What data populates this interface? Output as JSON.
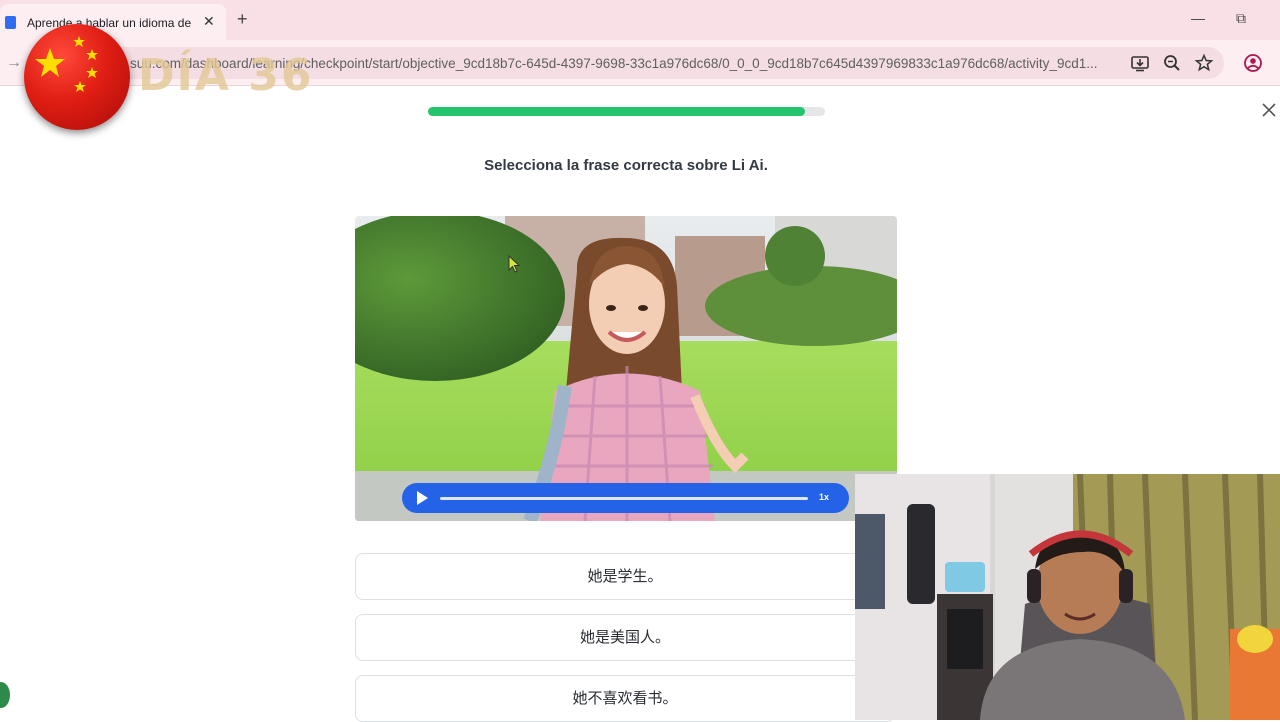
{
  "browser": {
    "tab_title": "Aprende a hablar un idioma de",
    "tab_close": "✕",
    "new_tab": "+",
    "url": "suu.com/dashboard/learning/checkpoint/start/objective_9cd18b7c-645d-4397-9698-33c1a976dc68/0_0_0_9cd18b7c645d4397969833c1a976dc68/activity_9cd1...",
    "minimize": "—",
    "restore": "⧉"
  },
  "overlay": {
    "day_label": "DÍA 36"
  },
  "lesson": {
    "progress_fraction": 0.95,
    "prompt": "Selecciona la frase correcta sobre Li Ai.",
    "audio_speed": "1x",
    "options": [
      {
        "text": "她是学生。"
      },
      {
        "text": "她是美国人。"
      },
      {
        "text": "她不喜欢看书。"
      }
    ]
  },
  "colors": {
    "accent_green": "#23c46c",
    "audio_blue": "#2462e8",
    "tabbar_pink": "#f9dfe6"
  }
}
